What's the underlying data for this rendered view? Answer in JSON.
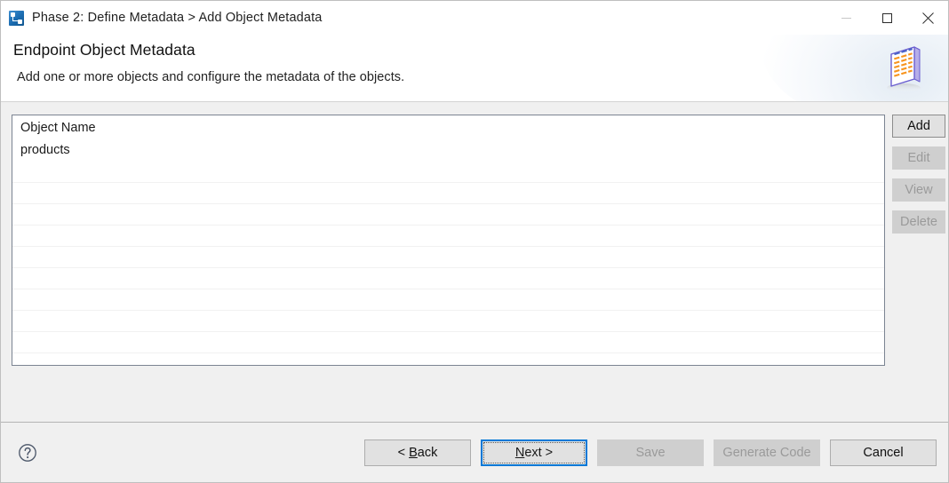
{
  "window": {
    "titlebar": {
      "app_icon": "node-diagram-icon",
      "title": "Phase 2: Define Metadata > Add Object Metadata",
      "controls": [
        {
          "name": "minimize",
          "icon": "minimize-icon",
          "enabled": false
        },
        {
          "name": "maximize",
          "icon": "maximize-icon",
          "enabled": true
        },
        {
          "name": "close",
          "icon": "close-icon",
          "enabled": true
        }
      ]
    },
    "header": {
      "title": "Endpoint Object Metadata",
      "subtitle": "Add one or more objects and configure the metadata of the objects.",
      "banner_icon": "table-grid-icon",
      "banner_icon_colors": {
        "border": "#6b5fd0",
        "cells": "#f7941e",
        "face": "#ffffff"
      }
    },
    "main": {
      "list": {
        "column_header": "Object Name",
        "rows": [
          "products"
        ],
        "empty_row_count": 10
      },
      "side_buttons": [
        {
          "label": "Add",
          "enabled": true
        },
        {
          "label": "Edit",
          "enabled": false
        },
        {
          "label": "View",
          "enabled": false
        },
        {
          "label": "Delete",
          "enabled": false
        }
      ]
    },
    "footer": {
      "help_icon": "question-mark-icon",
      "buttons": [
        {
          "label": "< Back",
          "mnemonic": "B",
          "enabled": true,
          "default": false
        },
        {
          "label": "Next >",
          "mnemonic": "N",
          "enabled": true,
          "default": true
        },
        {
          "label": "Save",
          "mnemonic": "",
          "enabled": false,
          "default": false
        },
        {
          "label": "Generate Code",
          "mnemonic": "",
          "enabled": false,
          "default": false
        },
        {
          "label": "Cancel",
          "mnemonic": "",
          "enabled": true,
          "default": false
        }
      ]
    },
    "colors": {
      "accent": "#0078d7",
      "window_bg": "#f0f0f0",
      "list_bg": "#ffffff",
      "list_border": "#7b8492",
      "disabled_text": "#9a9a9a"
    }
  }
}
